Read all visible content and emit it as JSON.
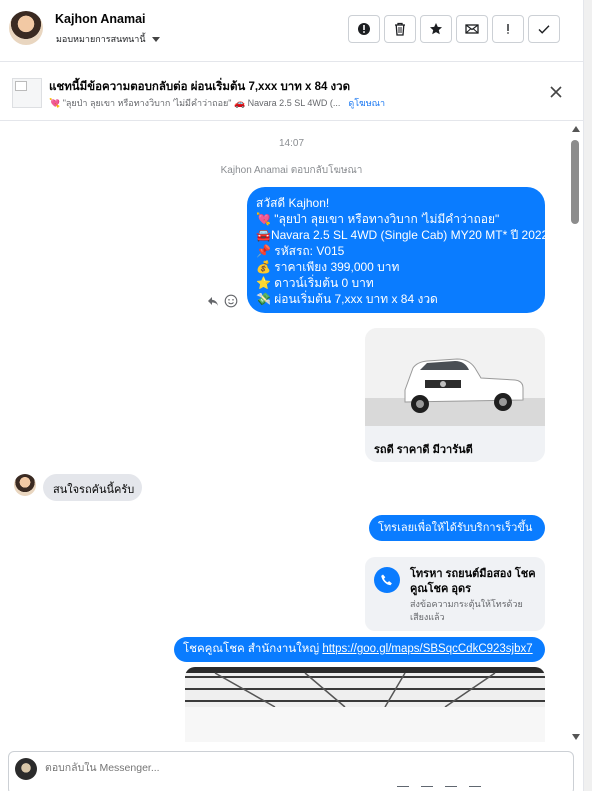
{
  "header": {
    "name": "Kajhon Anamai",
    "assign_label": "มอบหมายการสนทนานี้",
    "actions": [
      {
        "name": "mark-spam-button",
        "icon": "alert-circle-icon"
      },
      {
        "name": "delete-button",
        "icon": "trash-icon"
      },
      {
        "name": "star-button",
        "icon": "star-icon"
      },
      {
        "name": "mark-unread-button",
        "icon": "envelope-icon"
      },
      {
        "name": "follow-up-button",
        "icon": "exclamation-icon"
      },
      {
        "name": "mark-done-button",
        "icon": "checkmark-icon"
      }
    ]
  },
  "context": {
    "title": "แชทนี้มีข้อความตอบกลับต่อ ผ่อนเริ่มต้น 7,xxx บาท x 84 งวด",
    "subtitle": "💘 \"ลุยป่า ลุยเขา หรือทางวิบาก 'ไม่มีคำว่าถอย\" 🚗 Navara 2.5 SL 4WD (...",
    "link": "ดูโฆษณา"
  },
  "messages": {
    "time": "14:07",
    "replied_label": "Kajhon Anamai ตอบกลับโฆษณา",
    "bubble1": [
      "สวัสดี Kajhon!",
      "💘 \"ลุยป่า ลุยเขา หรือทางวิบาก 'ไม่มีคำว่าถอย\"",
      "🚘Navara 2.5 SL 4WD (Single Cab) MY20 MT* ปี 2022",
      "📌 รหัสรถ: V015",
      "💰 ราคาเพียง 399,000 บาท",
      "⭐ ดาวน์เริ่มต้น 0 บาท",
      "💸 ผ่อนเริ่มต้น 7,xxx บาท x 84 งวด"
    ],
    "card_label": "รถดี ราคาดี มีวารันตี",
    "incoming": "สนใจรถคันนี้ครับ",
    "bubble2": "โทรเลยเพื่อให้ได้รับบริการเร็วขึ้น",
    "call_title": "โทรหา รถยนต์มือสอง โชคคูณโชค อุดร",
    "call_sub": "ส่งข้อความกระตุ้นให้โทรด้วยเสียงแล้ว",
    "bubble3_prefix": "โชคคูณโชค สำนักงานใหญ่ ",
    "bubble3_url": "https://goo.gl/maps/SBSqcCdkC923sjbx7"
  },
  "composer": {
    "placeholder": "ตอบกลับใน Messenger..."
  },
  "colors": {
    "accent": "#0a7cff",
    "link": "#1877f2",
    "incoming_bubble": "#e4e6eb",
    "card_bg": "#f0f2f5"
  }
}
